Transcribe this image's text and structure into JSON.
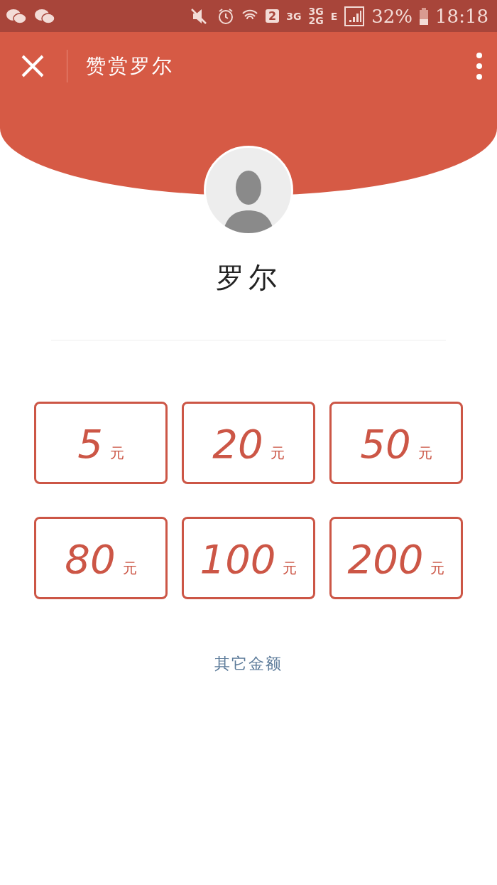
{
  "status_bar": {
    "sim_slot": "2",
    "network_1": "3G",
    "network_2_top": "3G",
    "network_2_bottom": "2G",
    "data_type": "E",
    "battery": "32%",
    "time": "18:18"
  },
  "header": {
    "title": "赞赏罗尔"
  },
  "profile": {
    "name": "罗尔"
  },
  "amounts": [
    {
      "value": "5",
      "unit": "元"
    },
    {
      "value": "20",
      "unit": "元"
    },
    {
      "value": "50",
      "unit": "元"
    },
    {
      "value": "80",
      "unit": "元"
    },
    {
      "value": "100",
      "unit": "元"
    },
    {
      "value": "200",
      "unit": "元"
    }
  ],
  "other_amount_link": "其它金额"
}
